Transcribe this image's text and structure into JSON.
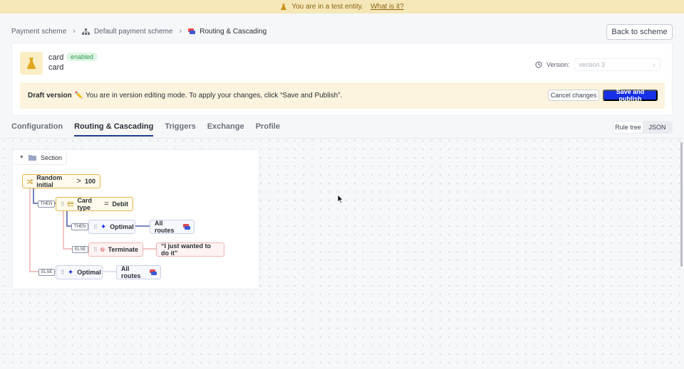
{
  "banner": {
    "text": "You are in a test entity.",
    "link": "What is it?"
  },
  "breadcrumb": {
    "items": [
      "Payment scheme",
      "Default payment scheme",
      "Routing & Cascading"
    ]
  },
  "header": {
    "back_label": "Back to scheme"
  },
  "scheme": {
    "name": "card",
    "status": "enabled",
    "subtitle": "card",
    "version_label": "Version:",
    "version_value": "version 3"
  },
  "draft": {
    "title": "Draft version",
    "message": "You are in version editing mode. To apply your changes, click “Save and Publish”.",
    "cancel_label": "Cancel changes",
    "save_label": "Save and publish"
  },
  "tabs": [
    "Configuration",
    "Routing & Cascading",
    "Triggers",
    "Exchange",
    "Profile"
  ],
  "active_tab": "Routing & Cascading",
  "view_toggle": [
    "Rule tree",
    "JSON"
  ],
  "tree": {
    "section_label": "Section",
    "root": {
      "label": "Random initial",
      "op": ">",
      "value": "100"
    },
    "card_rule": {
      "label": "Card type",
      "op": "=",
      "value": "Debit"
    },
    "optimal1": {
      "label": "Optimal",
      "target": "All routes"
    },
    "terminate": {
      "label": "Terminate",
      "message": "“I just wanted to do it”"
    },
    "optimal2": {
      "label": "Optimal",
      "target": "All routes"
    },
    "tag_then": "THEN",
    "tag_else": "ELSE"
  },
  "colors": {
    "primary": "#1530e6",
    "banner": "#f6e7b9",
    "draft_bg": "#fdf4df",
    "enabled": "#2f9b50"
  }
}
